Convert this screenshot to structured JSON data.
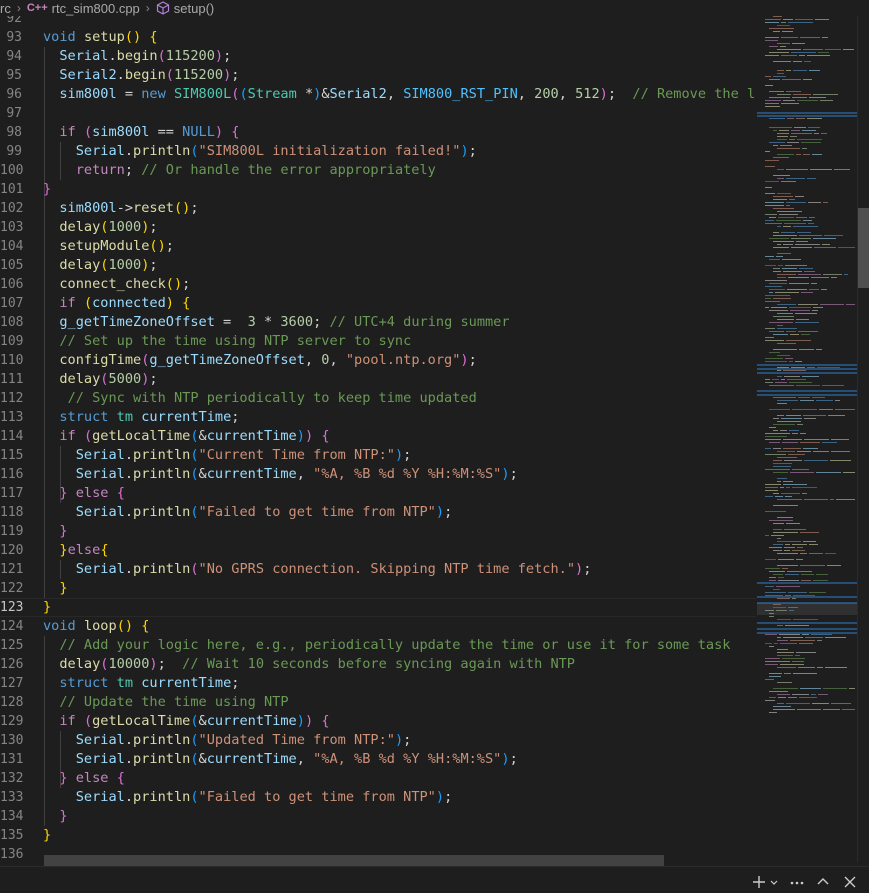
{
  "breadcrumb": {
    "root": "rc",
    "file": "rtc_sim800.cpp",
    "file_lang_icon": "C++",
    "symbol": "setup()"
  },
  "lines": [
    {
      "n": "92",
      "t": []
    },
    {
      "n": "93",
      "t": [
        [
          "k",
          "void"
        ],
        [
          "o",
          " "
        ],
        [
          "f",
          "setup"
        ],
        [
          "y",
          "()"
        ],
        [
          "o",
          " "
        ],
        [
          "y",
          "{"
        ]
      ]
    },
    {
      "n": "94",
      "t": [
        [
          "o",
          "  "
        ],
        [
          "v",
          "Serial"
        ],
        [
          "o",
          "."
        ],
        [
          "f",
          "begin"
        ],
        [
          "p",
          "("
        ],
        [
          "n",
          "115200"
        ],
        [
          "p",
          ")"
        ],
        [
          "o",
          ";"
        ]
      ]
    },
    {
      "n": "95",
      "t": [
        [
          "o",
          "  "
        ],
        [
          "v",
          "Serial2"
        ],
        [
          "o",
          "."
        ],
        [
          "f",
          "begin"
        ],
        [
          "p",
          "("
        ],
        [
          "n",
          "115200"
        ],
        [
          "p",
          ")"
        ],
        [
          "o",
          ";"
        ]
      ]
    },
    {
      "n": "96",
      "t": [
        [
          "o",
          "  "
        ],
        [
          "v",
          "sim800l"
        ],
        [
          "o",
          " = "
        ],
        [
          "k",
          "new"
        ],
        [
          "o",
          " "
        ],
        [
          "t",
          "SIM800L"
        ],
        [
          "p",
          "("
        ],
        [
          "b",
          "("
        ],
        [
          "t",
          "Stream"
        ],
        [
          "o",
          " *"
        ],
        [
          "b",
          ")"
        ],
        [
          "o",
          "&"
        ],
        [
          "v",
          "Serial2"
        ],
        [
          "o",
          ", "
        ],
        [
          "u",
          "SIM800_RST_PIN"
        ],
        [
          "o",
          ", "
        ],
        [
          "n",
          "200"
        ],
        [
          "o",
          ", "
        ],
        [
          "n",
          "512"
        ],
        [
          "p",
          ")"
        ],
        [
          "o",
          ";  "
        ],
        [
          "m",
          "// Remove the local d"
        ]
      ]
    },
    {
      "n": "97",
      "t": []
    },
    {
      "n": "98",
      "t": [
        [
          "o",
          "  "
        ],
        [
          "c",
          "if"
        ],
        [
          "o",
          " "
        ],
        [
          "p",
          "("
        ],
        [
          "v",
          "sim800l"
        ],
        [
          "o",
          " == "
        ],
        [
          "k",
          "NULL"
        ],
        [
          "p",
          ")"
        ],
        [
          "o",
          " "
        ],
        [
          "p",
          "{"
        ]
      ]
    },
    {
      "n": "99",
      "t": [
        [
          "o",
          "    "
        ],
        [
          "v",
          "Serial"
        ],
        [
          "o",
          "."
        ],
        [
          "f",
          "println"
        ],
        [
          "b",
          "("
        ],
        [
          "s",
          "\"SIM800L initialization failed!\""
        ],
        [
          "b",
          ")"
        ],
        [
          "o",
          ";"
        ]
      ]
    },
    {
      "n": "100",
      "t": [
        [
          "o",
          "    "
        ],
        [
          "c",
          "return"
        ],
        [
          "o",
          "; "
        ],
        [
          "m",
          "// Or handle the error appropriately"
        ]
      ]
    },
    {
      "n": "101",
      "t": [
        [
          "p",
          "}"
        ]
      ]
    },
    {
      "n": "102",
      "t": [
        [
          "o",
          "  "
        ],
        [
          "v",
          "sim800l"
        ],
        [
          "o",
          "->"
        ],
        [
          "f",
          "reset"
        ],
        [
          "y",
          "()"
        ],
        [
          "o",
          ";"
        ]
      ]
    },
    {
      "n": "103",
      "t": [
        [
          "o",
          "  "
        ],
        [
          "f",
          "delay"
        ],
        [
          "y",
          "("
        ],
        [
          "n",
          "1000"
        ],
        [
          "y",
          ")"
        ],
        [
          "o",
          ";"
        ]
      ]
    },
    {
      "n": "104",
      "t": [
        [
          "o",
          "  "
        ],
        [
          "f",
          "setupModule"
        ],
        [
          "y",
          "()"
        ],
        [
          "o",
          ";"
        ]
      ]
    },
    {
      "n": "105",
      "t": [
        [
          "o",
          "  "
        ],
        [
          "f",
          "delay"
        ],
        [
          "y",
          "("
        ],
        [
          "n",
          "1000"
        ],
        [
          "y",
          ")"
        ],
        [
          "o",
          ";"
        ]
      ]
    },
    {
      "n": "106",
      "t": [
        [
          "o",
          "  "
        ],
        [
          "f",
          "connect_check"
        ],
        [
          "y",
          "()"
        ],
        [
          "o",
          ";"
        ]
      ]
    },
    {
      "n": "107",
      "t": [
        [
          "o",
          "  "
        ],
        [
          "c",
          "if"
        ],
        [
          "o",
          " "
        ],
        [
          "y",
          "("
        ],
        [
          "v",
          "connected"
        ],
        [
          "y",
          ")"
        ],
        [
          "o",
          " "
        ],
        [
          "y",
          "{"
        ]
      ]
    },
    {
      "n": "108",
      "t": [
        [
          "o",
          "  "
        ],
        [
          "v",
          "g_getTimeZoneOffset"
        ],
        [
          "o",
          " =  "
        ],
        [
          "n",
          "3"
        ],
        [
          "o",
          " * "
        ],
        [
          "n",
          "3600"
        ],
        [
          "o",
          "; "
        ],
        [
          "m",
          "// UTC+4 during summer"
        ]
      ]
    },
    {
      "n": "109",
      "t": [
        [
          "o",
          "  "
        ],
        [
          "m",
          "// Set up the time using NTP server to sync"
        ]
      ]
    },
    {
      "n": "110",
      "t": [
        [
          "o",
          "  "
        ],
        [
          "f",
          "configTime"
        ],
        [
          "p",
          "("
        ],
        [
          "v",
          "g_getTimeZoneOffset"
        ],
        [
          "o",
          ", "
        ],
        [
          "n",
          "0"
        ],
        [
          "o",
          ", "
        ],
        [
          "s",
          "\"pool.ntp.org\""
        ],
        [
          "p",
          ")"
        ],
        [
          "o",
          ";"
        ]
      ]
    },
    {
      "n": "111",
      "t": [
        [
          "o",
          "  "
        ],
        [
          "f",
          "delay"
        ],
        [
          "p",
          "("
        ],
        [
          "n",
          "5000"
        ],
        [
          "p",
          ")"
        ],
        [
          "o",
          ";"
        ]
      ]
    },
    {
      "n": "112",
      "t": [
        [
          "o",
          "   "
        ],
        [
          "m",
          "// Sync with NTP periodically to keep time updated"
        ]
      ]
    },
    {
      "n": "113",
      "t": [
        [
          "o",
          "  "
        ],
        [
          "k",
          "struct"
        ],
        [
          "o",
          " "
        ],
        [
          "t",
          "tm"
        ],
        [
          "o",
          " "
        ],
        [
          "v",
          "currentTime"
        ],
        [
          "o",
          ";"
        ]
      ]
    },
    {
      "n": "114",
      "t": [
        [
          "o",
          "  "
        ],
        [
          "c",
          "if"
        ],
        [
          "o",
          " "
        ],
        [
          "p",
          "("
        ],
        [
          "f",
          "getLocalTime"
        ],
        [
          "b",
          "("
        ],
        [
          "o",
          "&"
        ],
        [
          "v",
          "currentTime"
        ],
        [
          "b",
          ")"
        ],
        [
          "p",
          ")"
        ],
        [
          "o",
          " "
        ],
        [
          "p",
          "{"
        ]
      ]
    },
    {
      "n": "115",
      "t": [
        [
          "o",
          "    "
        ],
        [
          "v",
          "Serial"
        ],
        [
          "o",
          "."
        ],
        [
          "f",
          "println"
        ],
        [
          "b",
          "("
        ],
        [
          "s",
          "\"Current Time from NTP:\""
        ],
        [
          "b",
          ")"
        ],
        [
          "o",
          ";"
        ]
      ]
    },
    {
      "n": "116",
      "t": [
        [
          "o",
          "    "
        ],
        [
          "v",
          "Serial"
        ],
        [
          "o",
          "."
        ],
        [
          "f",
          "println"
        ],
        [
          "b",
          "("
        ],
        [
          "o",
          "&"
        ],
        [
          "v",
          "currentTime"
        ],
        [
          "o",
          ", "
        ],
        [
          "s",
          "\"%A, %B %d %Y %H:%M:%S\""
        ],
        [
          "b",
          ")"
        ],
        [
          "o",
          ";"
        ]
      ]
    },
    {
      "n": "117",
      "t": [
        [
          "o",
          "  "
        ],
        [
          "p",
          "}"
        ],
        [
          "o",
          " "
        ],
        [
          "c",
          "else"
        ],
        [
          "o",
          " "
        ],
        [
          "p",
          "{"
        ]
      ]
    },
    {
      "n": "118",
      "t": [
        [
          "o",
          "    "
        ],
        [
          "v",
          "Serial"
        ],
        [
          "o",
          "."
        ],
        [
          "f",
          "println"
        ],
        [
          "b",
          "("
        ],
        [
          "s",
          "\"Failed to get time from NTP\""
        ],
        [
          "b",
          ")"
        ],
        [
          "o",
          ";"
        ]
      ]
    },
    {
      "n": "119",
      "t": [
        [
          "o",
          "  "
        ],
        [
          "p",
          "}"
        ]
      ]
    },
    {
      "n": "120",
      "t": [
        [
          "o",
          "  "
        ],
        [
          "y",
          "}"
        ],
        [
          "c",
          "else"
        ],
        [
          "y",
          "{"
        ]
      ]
    },
    {
      "n": "121",
      "t": [
        [
          "o",
          "    "
        ],
        [
          "v",
          "Serial"
        ],
        [
          "o",
          "."
        ],
        [
          "f",
          "println"
        ],
        [
          "p",
          "("
        ],
        [
          "s",
          "\"No GPRS connection. Skipping NTP time fetch.\""
        ],
        [
          "p",
          ")"
        ],
        [
          "o",
          ";"
        ]
      ]
    },
    {
      "n": "122",
      "t": [
        [
          "o",
          "  "
        ],
        [
          "y",
          "}"
        ]
      ]
    },
    {
      "n": "123",
      "t": [
        [
          "y",
          "}"
        ]
      ]
    },
    {
      "n": "124",
      "t": [
        [
          "k",
          "void"
        ],
        [
          "o",
          " "
        ],
        [
          "f",
          "loop"
        ],
        [
          "y",
          "()"
        ],
        [
          "o",
          " "
        ],
        [
          "y",
          "{"
        ]
      ]
    },
    {
      "n": "125",
      "t": [
        [
          "o",
          "  "
        ],
        [
          "m",
          "// Add your logic here, e.g., periodically update the time or use it for some task"
        ]
      ]
    },
    {
      "n": "126",
      "t": [
        [
          "o",
          "  "
        ],
        [
          "f",
          "delay"
        ],
        [
          "p",
          "("
        ],
        [
          "n",
          "10000"
        ],
        [
          "p",
          ")"
        ],
        [
          "o",
          ";  "
        ],
        [
          "m",
          "// Wait 10 seconds before syncing again with NTP"
        ]
      ]
    },
    {
      "n": "127",
      "t": [
        [
          "o",
          "  "
        ],
        [
          "k",
          "struct"
        ],
        [
          "o",
          " "
        ],
        [
          "t",
          "tm"
        ],
        [
          "o",
          " "
        ],
        [
          "v",
          "currentTime"
        ],
        [
          "o",
          ";"
        ]
      ]
    },
    {
      "n": "128",
      "t": [
        [
          "o",
          "  "
        ],
        [
          "m",
          "// Update the time using NTP"
        ]
      ]
    },
    {
      "n": "129",
      "t": [
        [
          "o",
          "  "
        ],
        [
          "c",
          "if"
        ],
        [
          "o",
          " "
        ],
        [
          "p",
          "("
        ],
        [
          "f",
          "getLocalTime"
        ],
        [
          "b",
          "("
        ],
        [
          "o",
          "&"
        ],
        [
          "v",
          "currentTime"
        ],
        [
          "b",
          ")"
        ],
        [
          "p",
          ")"
        ],
        [
          "o",
          " "
        ],
        [
          "p",
          "{"
        ]
      ]
    },
    {
      "n": "130",
      "t": [
        [
          "o",
          "    "
        ],
        [
          "v",
          "Serial"
        ],
        [
          "o",
          "."
        ],
        [
          "f",
          "println"
        ],
        [
          "b",
          "("
        ],
        [
          "s",
          "\"Updated Time from NTP:\""
        ],
        [
          "b",
          ")"
        ],
        [
          "o",
          ";"
        ]
      ]
    },
    {
      "n": "131",
      "t": [
        [
          "o",
          "    "
        ],
        [
          "v",
          "Serial"
        ],
        [
          "o",
          "."
        ],
        [
          "f",
          "println"
        ],
        [
          "b",
          "("
        ],
        [
          "o",
          "&"
        ],
        [
          "v",
          "currentTime"
        ],
        [
          "o",
          ", "
        ],
        [
          "s",
          "\"%A, %B %d %Y %H:%M:%S\""
        ],
        [
          "b",
          ")"
        ],
        [
          "o",
          ";"
        ]
      ]
    },
    {
      "n": "132",
      "t": [
        [
          "o",
          "  "
        ],
        [
          "p",
          "}"
        ],
        [
          "o",
          " "
        ],
        [
          "c",
          "else"
        ],
        [
          "o",
          " "
        ],
        [
          "p",
          "{"
        ]
      ]
    },
    {
      "n": "133",
      "t": [
        [
          "o",
          "    "
        ],
        [
          "v",
          "Serial"
        ],
        [
          "o",
          "."
        ],
        [
          "f",
          "println"
        ],
        [
          "b",
          "("
        ],
        [
          "s",
          "\"Failed to get time from NTP\""
        ],
        [
          "b",
          ")"
        ],
        [
          "o",
          ";"
        ]
      ]
    },
    {
      "n": "134",
      "t": [
        [
          "o",
          "  "
        ],
        [
          "p",
          "}"
        ]
      ]
    },
    {
      "n": "135",
      "t": [
        [
          "y",
          "}"
        ]
      ]
    },
    {
      "n": "136",
      "t": []
    }
  ],
  "active_line": "123",
  "status_icons": [
    "add-icon",
    "chevron-down-icon",
    "more-icon",
    "chevron-up-icon",
    "close-icon"
  ],
  "colors": {
    "background": "#1e1e1e",
    "keyword": "#569cd6",
    "control": "#c586c0",
    "function": "#dcdcaa",
    "variable": "#9cdcfe",
    "string": "#ce9178",
    "number": "#b5cea8",
    "comment": "#6a9955",
    "type": "#4ec9b0",
    "macro": "#4fc1ff",
    "line_number": "#858585"
  }
}
